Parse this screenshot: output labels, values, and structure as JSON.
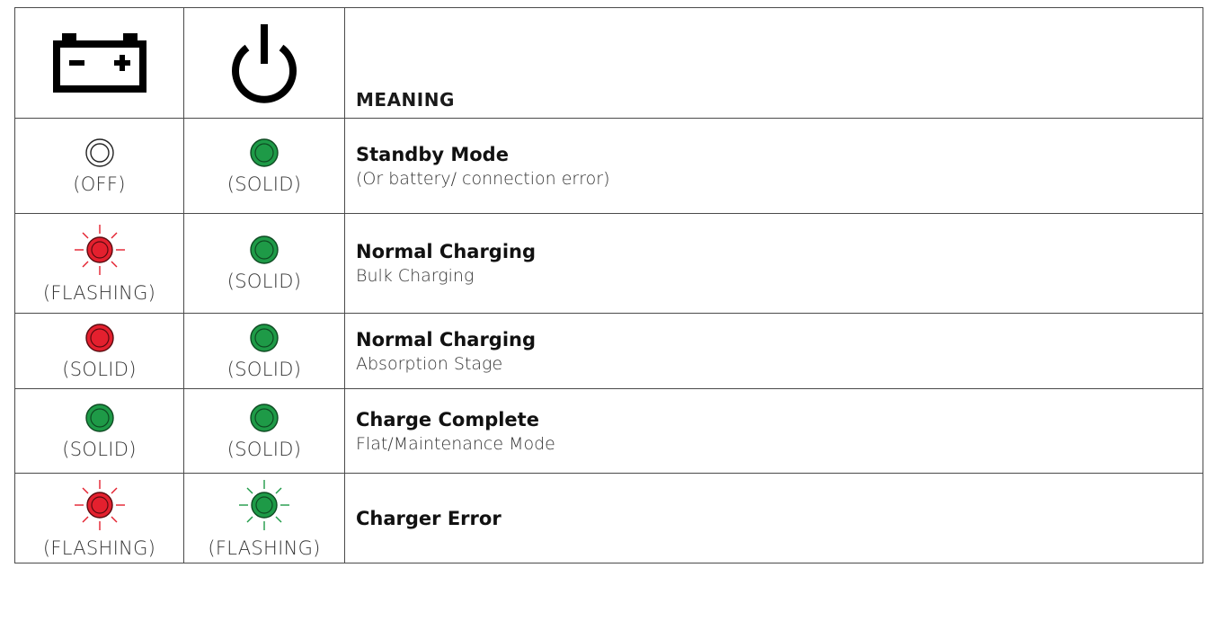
{
  "header": {
    "battery_icon": "battery-icon",
    "power_icon": "power-icon",
    "meaning_label": "MEANING"
  },
  "colors": {
    "red": "#e4202e",
    "green": "#1e9a47",
    "border": "#4a4a4a"
  },
  "rows": [
    {
      "battery": {
        "lamp": "off",
        "state": "(OFF)"
      },
      "power": {
        "lamp": "green-solid",
        "state": "(SOLID)"
      },
      "title": "Standby Mode",
      "description": "(Or battery/ connection error)"
    },
    {
      "battery": {
        "lamp": "red-flashing",
        "state": "(FLASHING)"
      },
      "power": {
        "lamp": "green-solid",
        "state": "(SOLID)"
      },
      "title": "Normal Charging",
      "description": "Bulk Charging"
    },
    {
      "battery": {
        "lamp": "red-solid",
        "state": "(SOLID)"
      },
      "power": {
        "lamp": "green-solid",
        "state": "(SOLID)"
      },
      "title": "Normal Charging",
      "description": "Absorption Stage"
    },
    {
      "battery": {
        "lamp": "green-solid",
        "state": "(SOLID)"
      },
      "power": {
        "lamp": "green-solid",
        "state": "(SOLID)"
      },
      "title": "Charge Complete",
      "description": "Flat/Maintenance Mode"
    },
    {
      "battery": {
        "lamp": "red-flashing",
        "state": "(FLASHING)"
      },
      "power": {
        "lamp": "green-flashing",
        "state": "(FLASHING)"
      },
      "title": "Charger Error",
      "description": ""
    }
  ]
}
